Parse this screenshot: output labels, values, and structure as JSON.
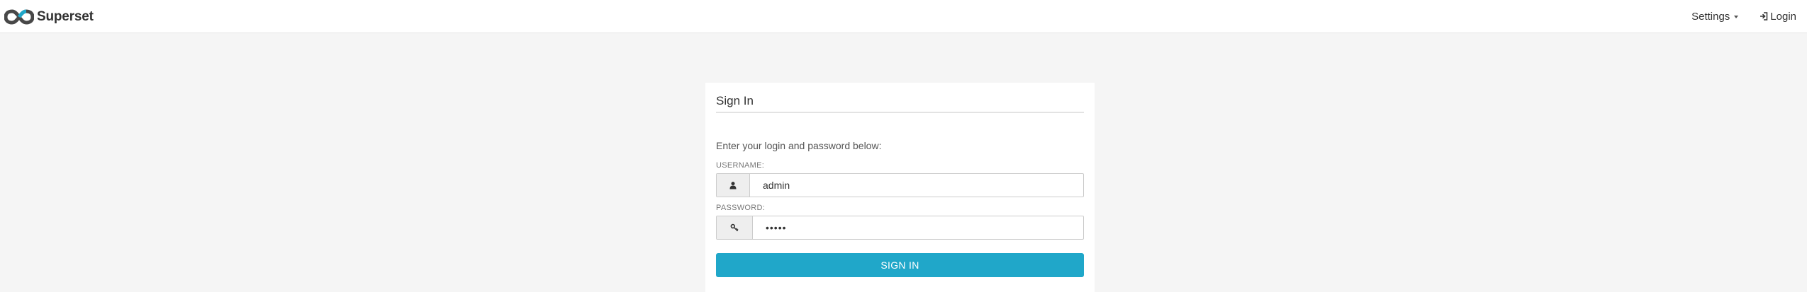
{
  "navbar": {
    "brand": "Superset",
    "settings_label": "Settings",
    "login_label": "Login"
  },
  "signin_panel": {
    "title": "Sign In",
    "instruction": "Enter your login and password below:",
    "username_label": "USERNAME:",
    "username_value": "admin",
    "password_label": "PASSWORD:",
    "password_masked": "•••••",
    "submit_label": "SIGN IN"
  },
  "colors": {
    "primary": "#20a7c9",
    "background": "#f5f5f5",
    "logo": "#484848"
  }
}
